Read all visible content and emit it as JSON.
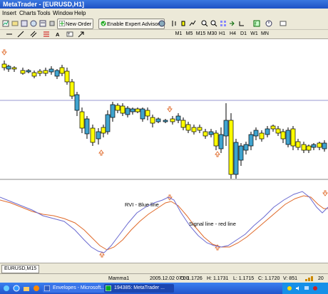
{
  "window": {
    "title": "MetaTrader - [EURUSD,H1]"
  },
  "menu": {
    "items": [
      "Insert",
      "Charts",
      "Tools",
      "Window",
      "Help"
    ]
  },
  "toolbar": {
    "new_order_label": "New Order",
    "expert_advisors_label": "Enable Expert Advisors",
    "timeframes": [
      "M1",
      "M5",
      "M15",
      "M30",
      "H1",
      "H4",
      "D1",
      "W1",
      "MN"
    ]
  },
  "chart": {
    "annotation_rvi": "RVI - Blue line",
    "annotation_signal": "Signal line - red line",
    "bull_color": "#ffff00",
    "bear_color": "#3fa3cf",
    "rvi_color": "#6a6ad0",
    "signal_color": "#e06a2a",
    "arrow_color": "#e06a2a"
  },
  "tabs": {
    "active": "EURUSD,M15"
  },
  "status": {
    "profile": "Mamma1",
    "datetime": "2005.12.02 07:00",
    "high": "H: 1.1731",
    "low": "L: 1.1715",
    "close": "C: 1.1720",
    "volume": "V: 851",
    "open": "O: 1.1726",
    "traffic": "20"
  },
  "taskbar": {
    "items": [
      "Envelopes - Microsoft...",
      "194385: MetaTrader ..."
    ]
  }
}
